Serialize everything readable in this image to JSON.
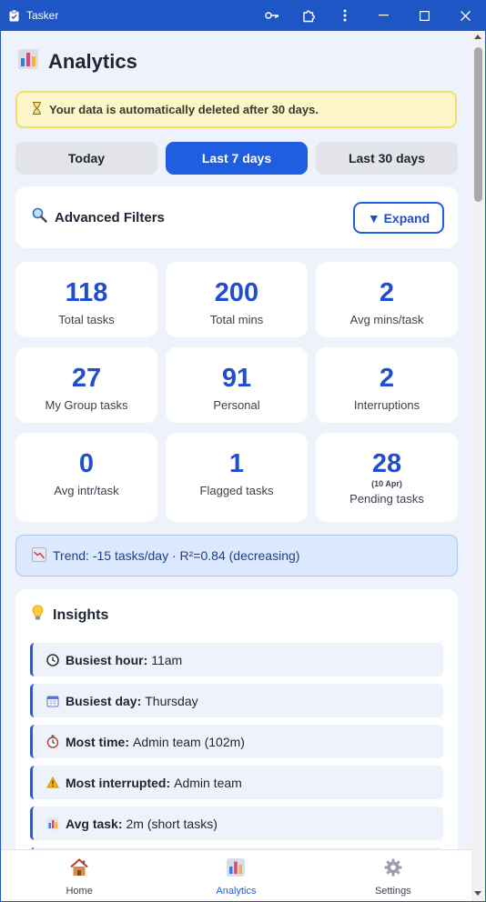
{
  "window": {
    "title": "Tasker"
  },
  "header": {
    "title": "Analytics"
  },
  "notice": {
    "text": "Your data is automatically deleted after 30 days."
  },
  "tabs": [
    {
      "label": "Today",
      "active": false
    },
    {
      "label": "Last 7 days",
      "active": true
    },
    {
      "label": "Last 30 days",
      "active": false
    }
  ],
  "filters": {
    "title": "Advanced Filters",
    "expand_label": "▼ Expand"
  },
  "stats": [
    {
      "value": "118",
      "label": "Total tasks"
    },
    {
      "value": "200",
      "label": "Total mins"
    },
    {
      "value": "2",
      "label": "Avg mins/task"
    },
    {
      "value": "27",
      "label": "My Group tasks"
    },
    {
      "value": "91",
      "label": "Personal"
    },
    {
      "value": "2",
      "label": "Interruptions"
    },
    {
      "value": "0",
      "label": "Avg intr/task"
    },
    {
      "value": "1",
      "label": "Flagged tasks"
    },
    {
      "value": "28",
      "sub": "(10 Apr)",
      "label": "Pending tasks"
    }
  ],
  "trend": {
    "text": "Trend: -15 tasks/day · R²=0.84 (decreasing)"
  },
  "insights": {
    "title": "Insights",
    "items": [
      {
        "icon": "clock-icon",
        "label": "Busiest hour:",
        "value": "11am"
      },
      {
        "icon": "calendar-icon",
        "label": "Busiest day:",
        "value": "Thursday"
      },
      {
        "icon": "stopwatch-icon",
        "label": "Most time:",
        "value": "Admin team (102m)"
      },
      {
        "icon": "warning-icon",
        "label": "Most interrupted:",
        "value": "Admin team"
      },
      {
        "icon": "bar-chart-icon",
        "label": "Avg task:",
        "value": "2m (short tasks)"
      }
    ]
  },
  "nav": [
    {
      "label": "Home",
      "icon": "house-icon",
      "active": false
    },
    {
      "label": "Analytics",
      "icon": "bar-chart-icon",
      "active": true
    },
    {
      "label": "Settings",
      "icon": "gear-icon",
      "active": false
    }
  ],
  "colors": {
    "accent": "#1f5ee0",
    "titlebar": "#1f56c5",
    "background": "#eef2fb"
  }
}
